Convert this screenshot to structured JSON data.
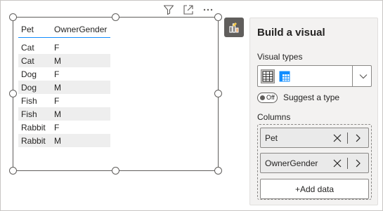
{
  "toolbar": {
    "icons": [
      "filter-icon",
      "focus-mode-icon",
      "more-options-icon"
    ]
  },
  "table": {
    "columns": [
      "Pet",
      "OwnerGender"
    ],
    "rows": [
      [
        "Cat",
        "F"
      ],
      [
        "Cat",
        "M"
      ],
      [
        "Dog",
        "F"
      ],
      [
        "Dog",
        "M"
      ],
      [
        "Fish",
        "F"
      ],
      [
        "Fish",
        "M"
      ],
      [
        "Rabbit",
        "F"
      ],
      [
        "Rabbit",
        "M"
      ]
    ]
  },
  "pane": {
    "title": "Build a visual",
    "visual_types_label": "Visual types",
    "visual_types": [
      "table-visual-icon",
      "matrix-visual-icon"
    ],
    "selected_visual_type": "table-visual-icon",
    "suggest_toggle_text": "Off",
    "suggest_label": "Suggest a type",
    "columns_label": "Columns",
    "fields": [
      "Pet",
      "OwnerGender"
    ],
    "add_data_label": "+Add data"
  },
  "colors": {
    "accent": "#118dff",
    "row_alt": "#eeeeee",
    "pane_bg": "#f3f2f1",
    "icon_bg": "#605e5c"
  }
}
